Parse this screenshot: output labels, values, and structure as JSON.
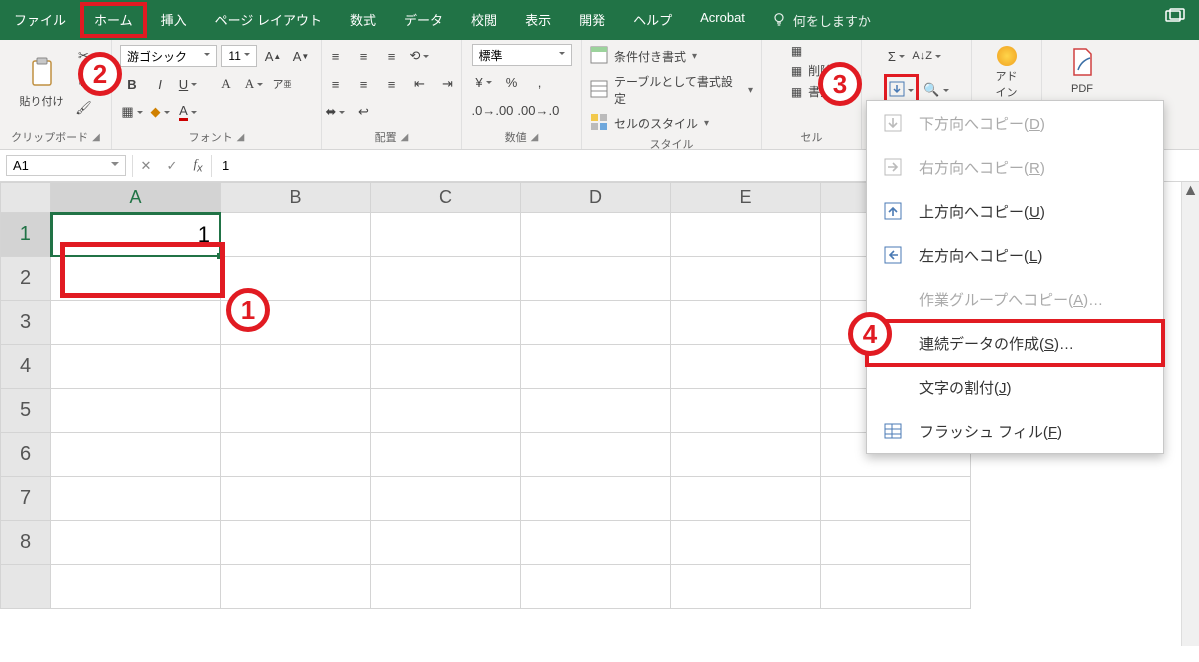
{
  "tabs": {
    "file": "ファイル",
    "home": "ホーム",
    "insert": "挿入",
    "page_layout": "ページ レイアウト",
    "formulas": "数式",
    "data": "データ",
    "review": "校閲",
    "view": "表示",
    "developer": "開発",
    "help": "ヘルプ",
    "acrobat": "Acrobat",
    "tell_me": "何をしますか"
  },
  "ribbon": {
    "clipboard": {
      "paste": "貼り付け",
      "group": "クリップボード"
    },
    "font": {
      "name": "游ゴシック",
      "size": "11",
      "group": "フォント",
      "bold": "B",
      "italic": "I",
      "underline": "U"
    },
    "alignment": {
      "group": "配置"
    },
    "number": {
      "format": "標準",
      "group": "数値"
    },
    "styles": {
      "cond_fmt": "条件付き書式",
      "as_table": "テーブルとして書式設定",
      "cell_styles": "セルのスタイル",
      "group": "スタイル"
    },
    "cells": {
      "delete": "削除",
      "format": "書式",
      "group": "セル"
    },
    "addins": {
      "label": "アド\nイン"
    },
    "pdf": {
      "label": "PDF"
    }
  },
  "fbar": {
    "name": "A1",
    "formula": "1"
  },
  "grid": {
    "cols": [
      "A",
      "B",
      "C",
      "D",
      "E"
    ],
    "rows": [
      "1",
      "2",
      "3",
      "4",
      "5",
      "6",
      "7",
      "8"
    ],
    "a1": "1"
  },
  "fill_menu": {
    "down": {
      "label": "下方向へコピー(",
      "key": "D",
      "tail": ")"
    },
    "right": {
      "label": "右方向へコピー(",
      "key": "R",
      "tail": ")"
    },
    "up": {
      "label": "上方向へコピー(",
      "key": "U",
      "tail": ")"
    },
    "left": {
      "label": "左方向へコピー(",
      "key": "L",
      "tail": ")"
    },
    "group": {
      "label": "作業グループへコピー(",
      "key": "A",
      "tail": ")…"
    },
    "series": {
      "label": "連続データの作成(",
      "key": "S",
      "tail": ")…"
    },
    "justify": {
      "label": "文字の割付(",
      "key": "J",
      "tail": ")"
    },
    "flash": {
      "label": "フラッシュ フィル(",
      "key": "F",
      "tail": ")"
    }
  },
  "callouts": {
    "c1": "1",
    "c2": "2",
    "c3": "3",
    "c4": "4"
  }
}
